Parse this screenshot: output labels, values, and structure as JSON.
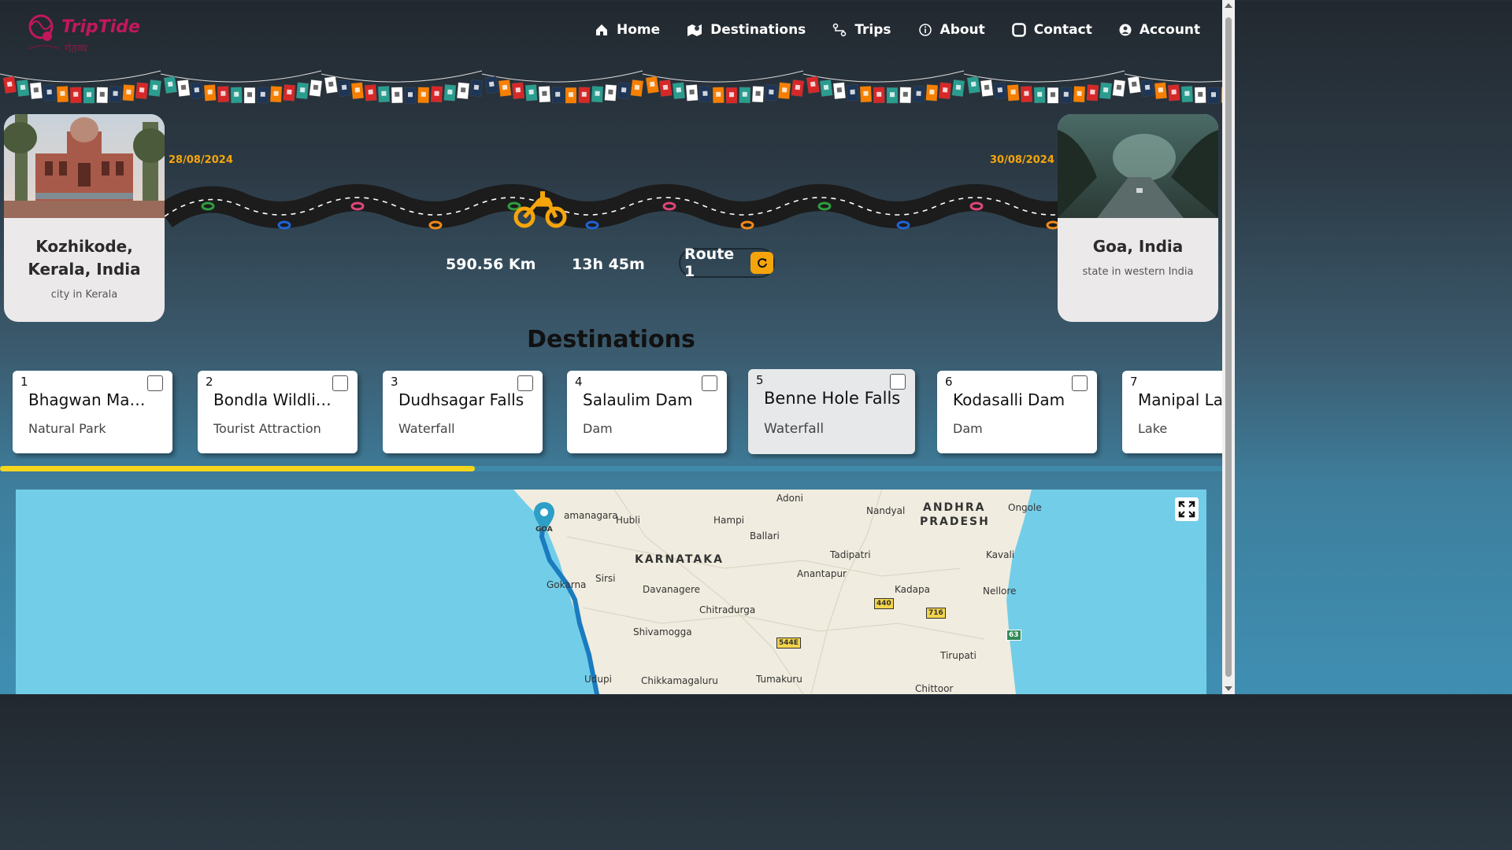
{
  "brand": {
    "name": "TripTide",
    "sub": "गंतव्य"
  },
  "nav": [
    {
      "label": "Home",
      "icon": "home-icon"
    },
    {
      "label": "Destinations",
      "icon": "map-icon"
    },
    {
      "label": "Trips",
      "icon": "trips-icon"
    },
    {
      "label": "About",
      "icon": "info-icon"
    },
    {
      "label": "Contact",
      "icon": "contact-icon"
    },
    {
      "label": "Account",
      "icon": "account-icon"
    }
  ],
  "trip": {
    "origin": {
      "name": "Kozhikode, Kerala, India",
      "desc": "city in Kerala",
      "date": "28/08/2024"
    },
    "destination": {
      "name": "Goa, India",
      "desc": "state in western India",
      "date": "30/08/2024"
    },
    "distance": "590.56 Km",
    "duration": "13h 45m",
    "route_label": "Route 1"
  },
  "destinations": {
    "title": "Destinations",
    "items": [
      {
        "num": "1",
        "name": "Bhagwan Mah...",
        "type": "Natural Park"
      },
      {
        "num": "2",
        "name": "Bondla Wildlife ...",
        "type": "Tourist Attraction"
      },
      {
        "num": "3",
        "name": "Dudhsagar Falls",
        "type": "Waterfall"
      },
      {
        "num": "4",
        "name": "Salaulim Dam",
        "type": "Dam"
      },
      {
        "num": "5",
        "name": "Benne Hole Falls",
        "type": "Waterfall"
      },
      {
        "num": "6",
        "name": "Kodasalli Dam",
        "type": "Dam"
      },
      {
        "num": "7",
        "name": "Manipal La",
        "type": "Lake"
      }
    ]
  },
  "map": {
    "states": [
      "KARNATAKA",
      "ANDHRA",
      "PRADESH"
    ],
    "places": [
      "Adoni",
      "Nandyal",
      "Ongole",
      "amanagara",
      "Hubli",
      "Hampi",
      "Ballari",
      "Tadipatri",
      "Kavali",
      "Gokarna",
      "Sirsi",
      "Anantapur",
      "Davanagere",
      "Kadapa",
      "Nellore",
      "Chitradurga",
      "Shivamogga",
      "Tirupati",
      "Udupi",
      "Chikkamagaluru",
      "Tumakuru",
      "Chittoor",
      "GOA"
    ],
    "shields": [
      "440",
      "716",
      "544E",
      "63"
    ]
  },
  "colors": {
    "accent": "#f5a50b",
    "scroll_thumb": "#f7d51d",
    "route": "#1a7bbf"
  }
}
